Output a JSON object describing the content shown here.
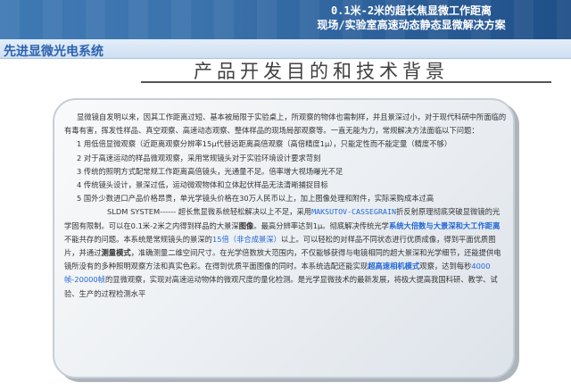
{
  "header": {
    "title_line1": "0.1米-2米的超长焦显微工作距离",
    "title_line2": "现场/实验室高速动态静态显微解决方案"
  },
  "brand": "先进显微光电系统",
  "page_title": "产品开发目的和技术背景",
  "body": {
    "intro": "显微镜自发明以来，因其工作距离过短、基本被局限于实验桌上，所观察的物体也需制样，并且景深过小，对于现代科研中所面临的有毒有害，挥发性样品、真空观察、高速动态观察、整体样品的现场局部观察等。一直无能为力，常规解决方法面临以下问题：",
    "items": [
      "1  用低倍显微观察（近距离观察分辨率15μ代替远距离高倍观察（高倍精度1μ），只能定性而不能定量（精度不够）",
      "2  对于高速运动的样品微观观察，采用常规镜头对于实验环境设计要求苛刻",
      "3  传统的照明方式配常规工作距离高倍镜头，光通量不足。倍率增大视场曝光不足",
      "4  传统镜头设计，景深过低，运动微观物体和立体起伏样品无法清晰捕捉目标",
      "5  国外少数进口产品价格昂贵，单光学镜头价格在30万人民币以上，加上图像处理和附件，实际采购成本过高"
    ],
    "para2_a": "SLDM SYSTEM------ 超长焦显微系统轻松解决以上不足，采用",
    "para2_b": "MAKSUTOV-CASSEGRAIN",
    "para2_c": "折反射原理彻底突破显微镜的光学固有限制。可以在0.1米-2米之内得到样品的大景深",
    "para2_d": "图像",
    "para2_e": "。最高分辨率达到1μ。彻底解决传统光学",
    "para2_f": "系统大倍数与大景深和大工作距离",
    "para2_g": "不能共存的问题。本系统是常规镜头的景深的",
    "para2_h": "15倍（非合成景深）",
    "para2_i": "以上。可以轻松的对样品不同状态进行优质成像，得到平面优质图片，并通过",
    "para2_j": "测量模式",
    "para2_k": "，准确测量二维空间尺寸。在光学倍数放大范围内，不仅能够获得与电镜相同的超大景深和光学细节，还能提供电镜所没有的多种照明观察方法和真实色彩。在得到优质平面图像的同时。本系统选配还能实现",
    "para2_l": "超高速相机模式",
    "para2_m": "观察，达到每秒",
    "para2_n": "4000帧-20000帧",
    "para2_o": "的显微观察，实现对高速运动物体的微观尺度的量化检测。是光学显微技术的最新发展，将极大提高我国科研、教学、试验、生产的过程检测水平"
  },
  "colors": {
    "band": "#3b73ad",
    "brand_text": "#2a62b0",
    "highlight": "#2066d6"
  }
}
